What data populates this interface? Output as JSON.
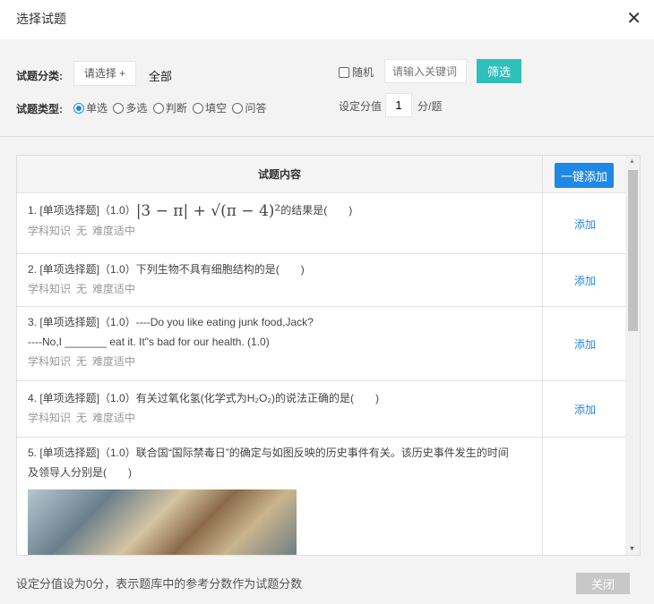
{
  "title": "选择试题",
  "filters": {
    "category_label": "试题分类:",
    "category_button": "请选择 +",
    "category_value": "全部",
    "type_label": "试题类型:",
    "types": [
      "单选",
      "多选",
      "判断",
      "填空",
      "问答"
    ],
    "selected_type": "单选",
    "random_label": "随机",
    "keyword_placeholder": "请输入关键词",
    "filter_button": "筛选",
    "score_label": "设定分值",
    "score_value": "1",
    "score_unit": "分/题"
  },
  "table": {
    "header": "试题内容",
    "add_all": "一键添加",
    "add_label": "添加",
    "rows": [
      {
        "prefix": "1. [单项选择题]（1.0）",
        "math": "|3 − π| + √(π − 4)²",
        "text": "的结果是(　　)",
        "meta": [
          "学科知识",
          "无",
          "难度适中"
        ]
      },
      {
        "prefix": "2. [单项选择题]（1.0）",
        "text": "下列生物不具有细胞结构的是(　　)",
        "meta": [
          "学科知识",
          "无",
          "难度适中"
        ]
      },
      {
        "prefix": "3. [单项选择题]（1.0）",
        "text": "----Do you like eating junk food,Jack?",
        "text2": "----No,I _______ eat it. It\"s bad for our health. (1.0)",
        "meta": [
          "学科知识",
          "无",
          "难度适中"
        ]
      },
      {
        "prefix": "4. [单项选择题]（1.0）",
        "text": "有关过氧化氢(化学式为H₂O₂)的说法正确的是(　　)",
        "meta": [
          "学科知识",
          "无",
          "难度适中"
        ]
      },
      {
        "prefix": "5. [单项选择题]（1.0）",
        "text": "联合国“国际禁毒日”的确定与如图反映的历史事件有关。该历史事件发生的时间",
        "text2": "及领导人分别是(　　)"
      }
    ]
  },
  "footer": {
    "note": "设定分值设为0分，表示题库中的参考分数作为试题分数",
    "close": "关闭"
  }
}
